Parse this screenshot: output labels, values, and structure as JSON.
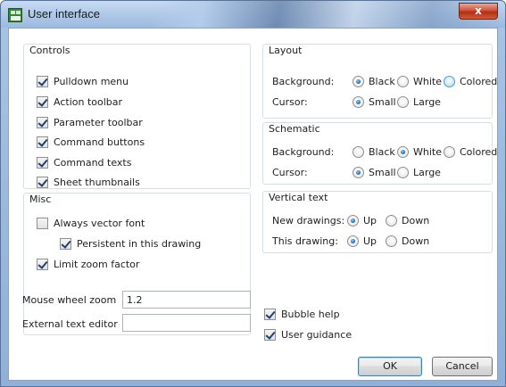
{
  "window": {
    "title": "User interface",
    "close_label": "x"
  },
  "controls": {
    "title": "Controls",
    "items": [
      {
        "label": "Pulldown menu",
        "checked": true
      },
      {
        "label": "Action toolbar",
        "checked": true
      },
      {
        "label": "Parameter toolbar",
        "checked": true
      },
      {
        "label": "Command buttons",
        "checked": true
      },
      {
        "label": "Command texts",
        "checked": true
      },
      {
        "label": "Sheet thumbnails",
        "checked": true
      }
    ]
  },
  "misc": {
    "title": "Misc",
    "always_vector_font": {
      "label": "Always vector font",
      "checked": false
    },
    "persistent": {
      "label": "Persistent in this drawing",
      "checked": true
    },
    "limit_zoom": {
      "label": "Limit zoom factor",
      "checked": true
    },
    "mouse_wheel_zoom": {
      "label": "Mouse wheel zoom",
      "value": "1.2"
    },
    "external_text_editor": {
      "label": "External text editor",
      "value": ""
    }
  },
  "layout": {
    "title": "Layout",
    "background": {
      "label": "Background:",
      "options": [
        "Black",
        "White",
        "Colored"
      ],
      "selected": "Black"
    },
    "cursor": {
      "label": "Cursor:",
      "options": [
        "Small",
        "Large"
      ],
      "selected": "Small"
    }
  },
  "schematic": {
    "title": "Schematic",
    "background": {
      "label": "Background:",
      "options": [
        "Black",
        "White",
        "Colored"
      ],
      "selected": "White"
    },
    "cursor": {
      "label": "Cursor:",
      "options": [
        "Small",
        "Large"
      ],
      "selected": "Small"
    }
  },
  "vertical_text": {
    "title": "Vertical text",
    "new_drawings": {
      "label": "New drawings:",
      "options": [
        "Up",
        "Down"
      ],
      "selected": "Up"
    },
    "this_drawing": {
      "label": "This drawing:",
      "options": [
        "Up",
        "Down"
      ],
      "selected": "Up"
    }
  },
  "bubble_help": {
    "label": "Bubble help",
    "checked": true
  },
  "user_guidance": {
    "label": "User guidance",
    "checked": true
  },
  "buttons": {
    "ok": "OK",
    "cancel": "Cancel"
  }
}
